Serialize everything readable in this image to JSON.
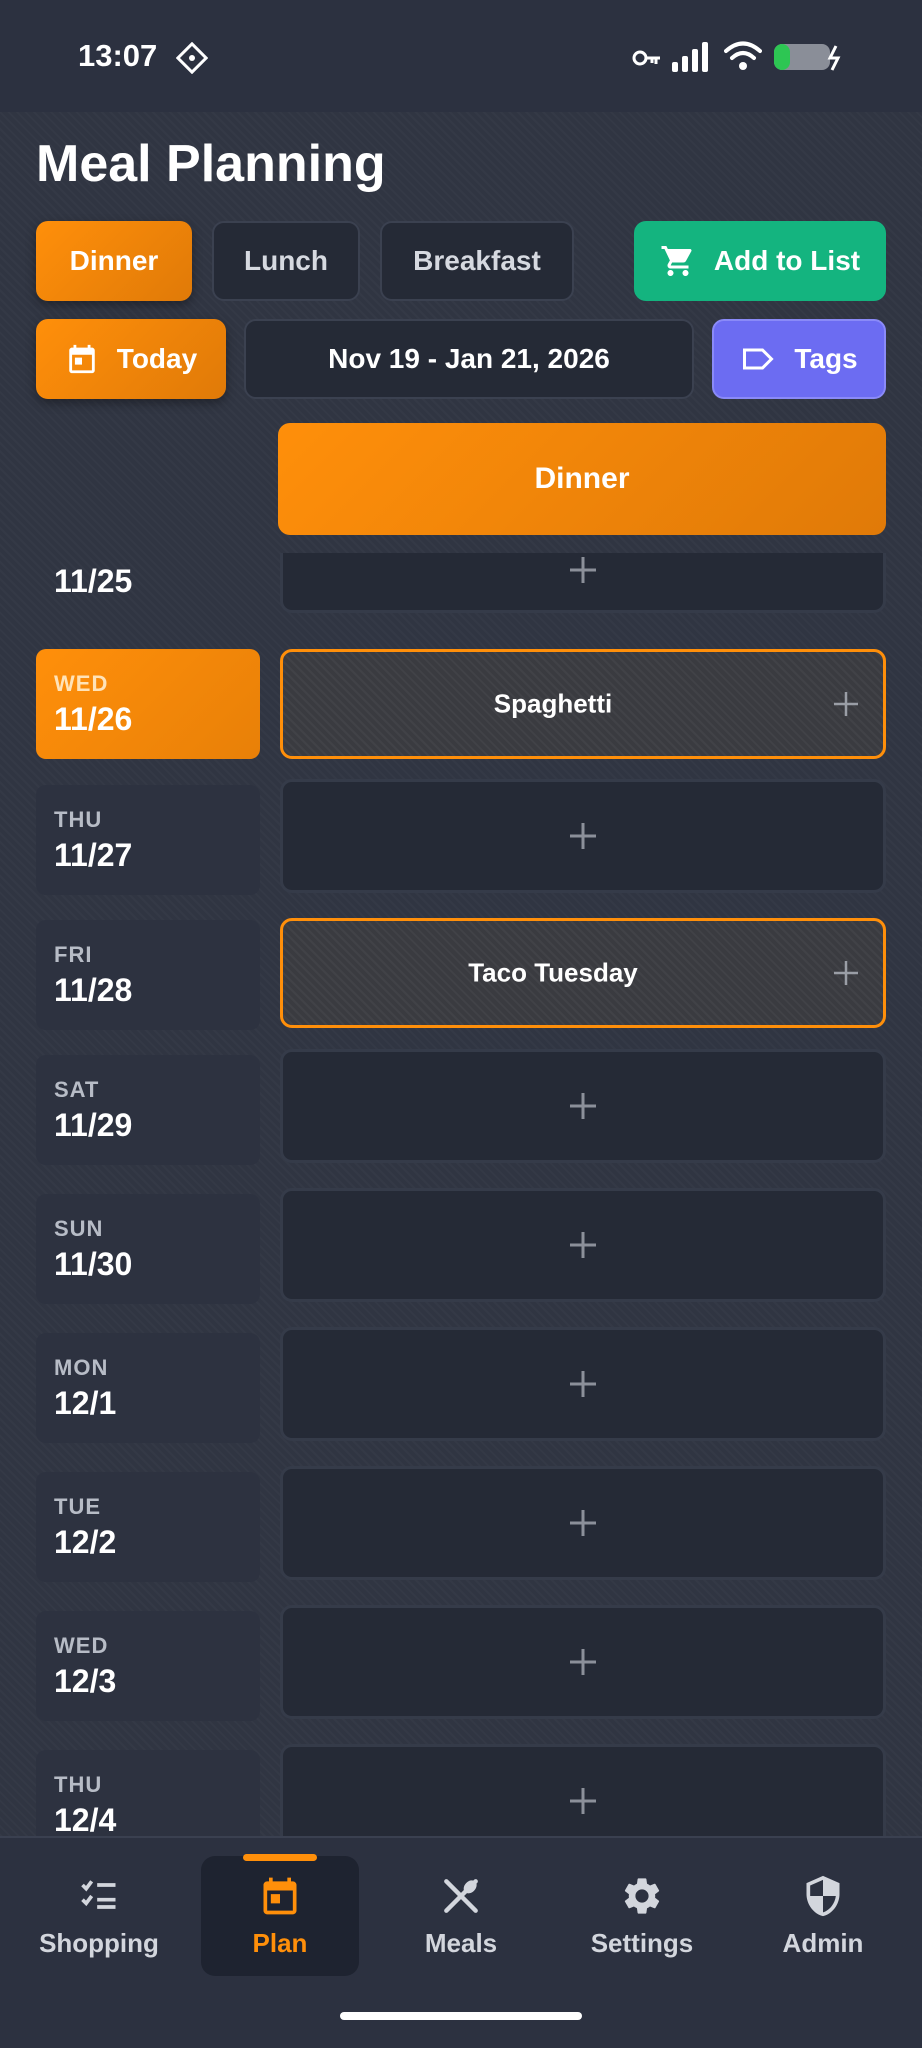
{
  "status_bar": {
    "time": "13:07"
  },
  "header": {
    "title": "Meal Planning"
  },
  "meal_tabs": [
    {
      "label": "Dinner",
      "active": true
    },
    {
      "label": "Lunch",
      "active": false
    },
    {
      "label": "Breakfast",
      "active": false
    }
  ],
  "add_to_list": {
    "label": "Add to List",
    "icon": "cart-icon"
  },
  "today_button": {
    "label": "Today",
    "icon": "calendar-icon"
  },
  "date_range": "Nov 19 - Jan 21, 2026",
  "tags_button": {
    "label": "Tags",
    "icon": "tag-icon"
  },
  "column_header": "Dinner",
  "partial_top_day": {
    "date": "11/25"
  },
  "days": [
    {
      "dow": "WED",
      "date": "11/26",
      "today": true,
      "meal": "Spaghetti"
    },
    {
      "dow": "THU",
      "date": "11/27",
      "today": false,
      "meal": ""
    },
    {
      "dow": "FRI",
      "date": "11/28",
      "today": false,
      "meal": "Taco Tuesday"
    },
    {
      "dow": "SAT",
      "date": "11/29",
      "today": false,
      "meal": ""
    },
    {
      "dow": "SUN",
      "date": "11/30",
      "today": false,
      "meal": ""
    },
    {
      "dow": "MON",
      "date": "12/1",
      "today": false,
      "meal": ""
    },
    {
      "dow": "TUE",
      "date": "12/2",
      "today": false,
      "meal": ""
    },
    {
      "dow": "WED",
      "date": "12/3",
      "today": false,
      "meal": ""
    },
    {
      "dow": "THU",
      "date": "12/4",
      "today": false,
      "meal": ""
    }
  ],
  "bottom_nav": [
    {
      "label": "Shopping",
      "icon": "checklist-icon",
      "active": false
    },
    {
      "label": "Plan",
      "icon": "calendar-icon",
      "active": true
    },
    {
      "label": "Meals",
      "icon": "utensils-icon",
      "active": false
    },
    {
      "label": "Settings",
      "icon": "gear-icon",
      "active": false
    },
    {
      "label": "Admin",
      "icon": "shield-icon",
      "active": false
    }
  ],
  "colors": {
    "accent": "#ff8f0a",
    "green": "#14b47f",
    "purple": "#6c6cf2",
    "background": "#303542"
  }
}
